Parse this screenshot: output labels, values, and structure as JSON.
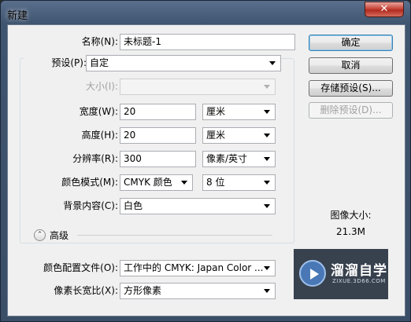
{
  "window": {
    "title": "新建",
    "close_glyph": "✕"
  },
  "form": {
    "name_label": "名称(N):",
    "name_value": "未标题-1",
    "preset_label": "预设(P):",
    "preset_value": "自定",
    "size_label": "大小(I):",
    "size_value": "",
    "width_label": "宽度(W):",
    "width_value": "20",
    "width_unit": "厘米",
    "height_label": "高度(H):",
    "height_value": "20",
    "height_unit": "厘米",
    "resolution_label": "分辨率(R):",
    "resolution_value": "300",
    "resolution_unit": "像素/英寸",
    "color_mode_label": "颜色模式(M):",
    "color_mode_value": "CMYK 颜色",
    "bit_depth_value": "8 位",
    "background_label": "背景内容(C):",
    "background_value": "白色",
    "advanced_label": "高级",
    "advanced_toggle_glyph": "⌃",
    "color_profile_label": "颜色配置文件(O):",
    "color_profile_value": "工作中的 CMYK: Japan Color ...",
    "pixel_aspect_label": "像素长宽比(X):",
    "pixel_aspect_value": "方形像素"
  },
  "buttons": {
    "ok": "确定",
    "cancel": "取消",
    "save_preset": "存储预设(S)...",
    "delete_preset": "删除预设(D)..."
  },
  "image_size": {
    "label": "图像大小:",
    "value": "21.3M"
  },
  "watermark": {
    "text": "溜溜自学",
    "sub": "ZIXUE.3D66.COM"
  }
}
